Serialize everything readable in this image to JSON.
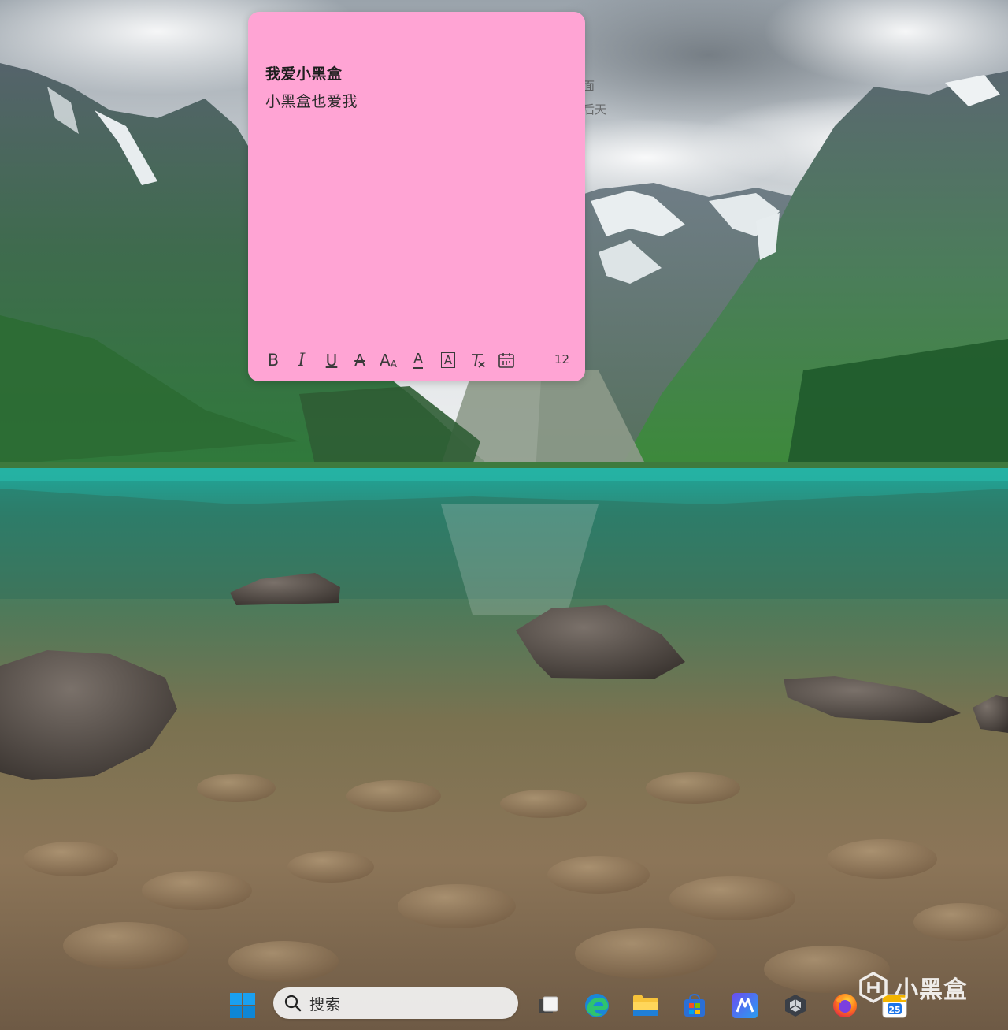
{
  "sticky_note": {
    "title": "我爱小黑盒",
    "body": "小黑盒也爱我",
    "color": "#ffa4d4",
    "toolbar": {
      "bold_label": "B",
      "italic_label": "I",
      "underline_label": "U",
      "strikethrough_label": "A",
      "font_size_label": "A",
      "font_color_label": "A",
      "highlight_label": "A",
      "char_count": "12"
    }
  },
  "widget_peek": {
    "line1": "面",
    "line2": "后天"
  },
  "taskbar": {
    "search_label": "搜索",
    "calendar_badge": "25",
    "icons": [
      "windows-start-icon",
      "search-icon",
      "task-view-icon",
      "edge-icon",
      "file-explorer-icon",
      "microsoft-store-icon",
      "app-m-icon",
      "app-unity-icon",
      "firefox-icon",
      "calendar-icon"
    ]
  },
  "watermark": {
    "text": "小黑盒"
  }
}
